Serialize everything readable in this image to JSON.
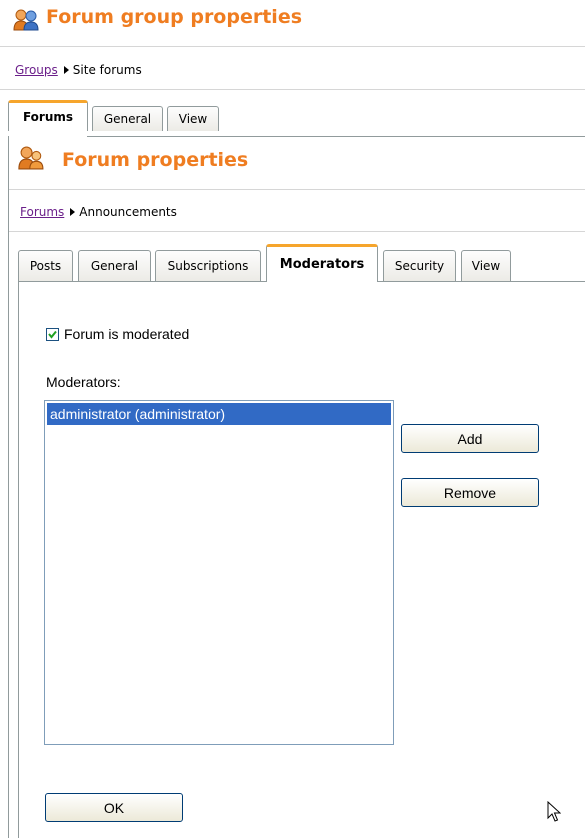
{
  "header": {
    "title": "Forum group properties",
    "icon": "users-icon",
    "accent": "#ef7d21"
  },
  "breadcrumb": {
    "link": "Groups",
    "current": "Site forums"
  },
  "outer_tabs": [
    {
      "label": "Forums",
      "active": true
    },
    {
      "label": "General",
      "active": false
    },
    {
      "label": "View",
      "active": false
    }
  ],
  "forum": {
    "title": "Forum properties",
    "icon": "users-icon",
    "breadcrumb_link": "Forums",
    "breadcrumb_current": "Announcements"
  },
  "inner_tabs": [
    {
      "label": "Posts",
      "active": false
    },
    {
      "label": "General",
      "active": false
    },
    {
      "label": "Subscriptions",
      "active": false
    },
    {
      "label": "Moderators",
      "active": true
    },
    {
      "label": "Security",
      "active": false
    },
    {
      "label": "View",
      "active": false
    }
  ],
  "moderation": {
    "checkbox_label": "Forum is moderated",
    "checked": true,
    "moderators_label": "Moderators:",
    "moderators": [
      "administrator (administrator)"
    ],
    "add_label": "Add",
    "remove_label": "Remove",
    "ok_label": "OK"
  },
  "colors": {
    "selection": "#316ac5",
    "tab_highlight": "#f6a52c",
    "link": "#6b1f8a"
  }
}
